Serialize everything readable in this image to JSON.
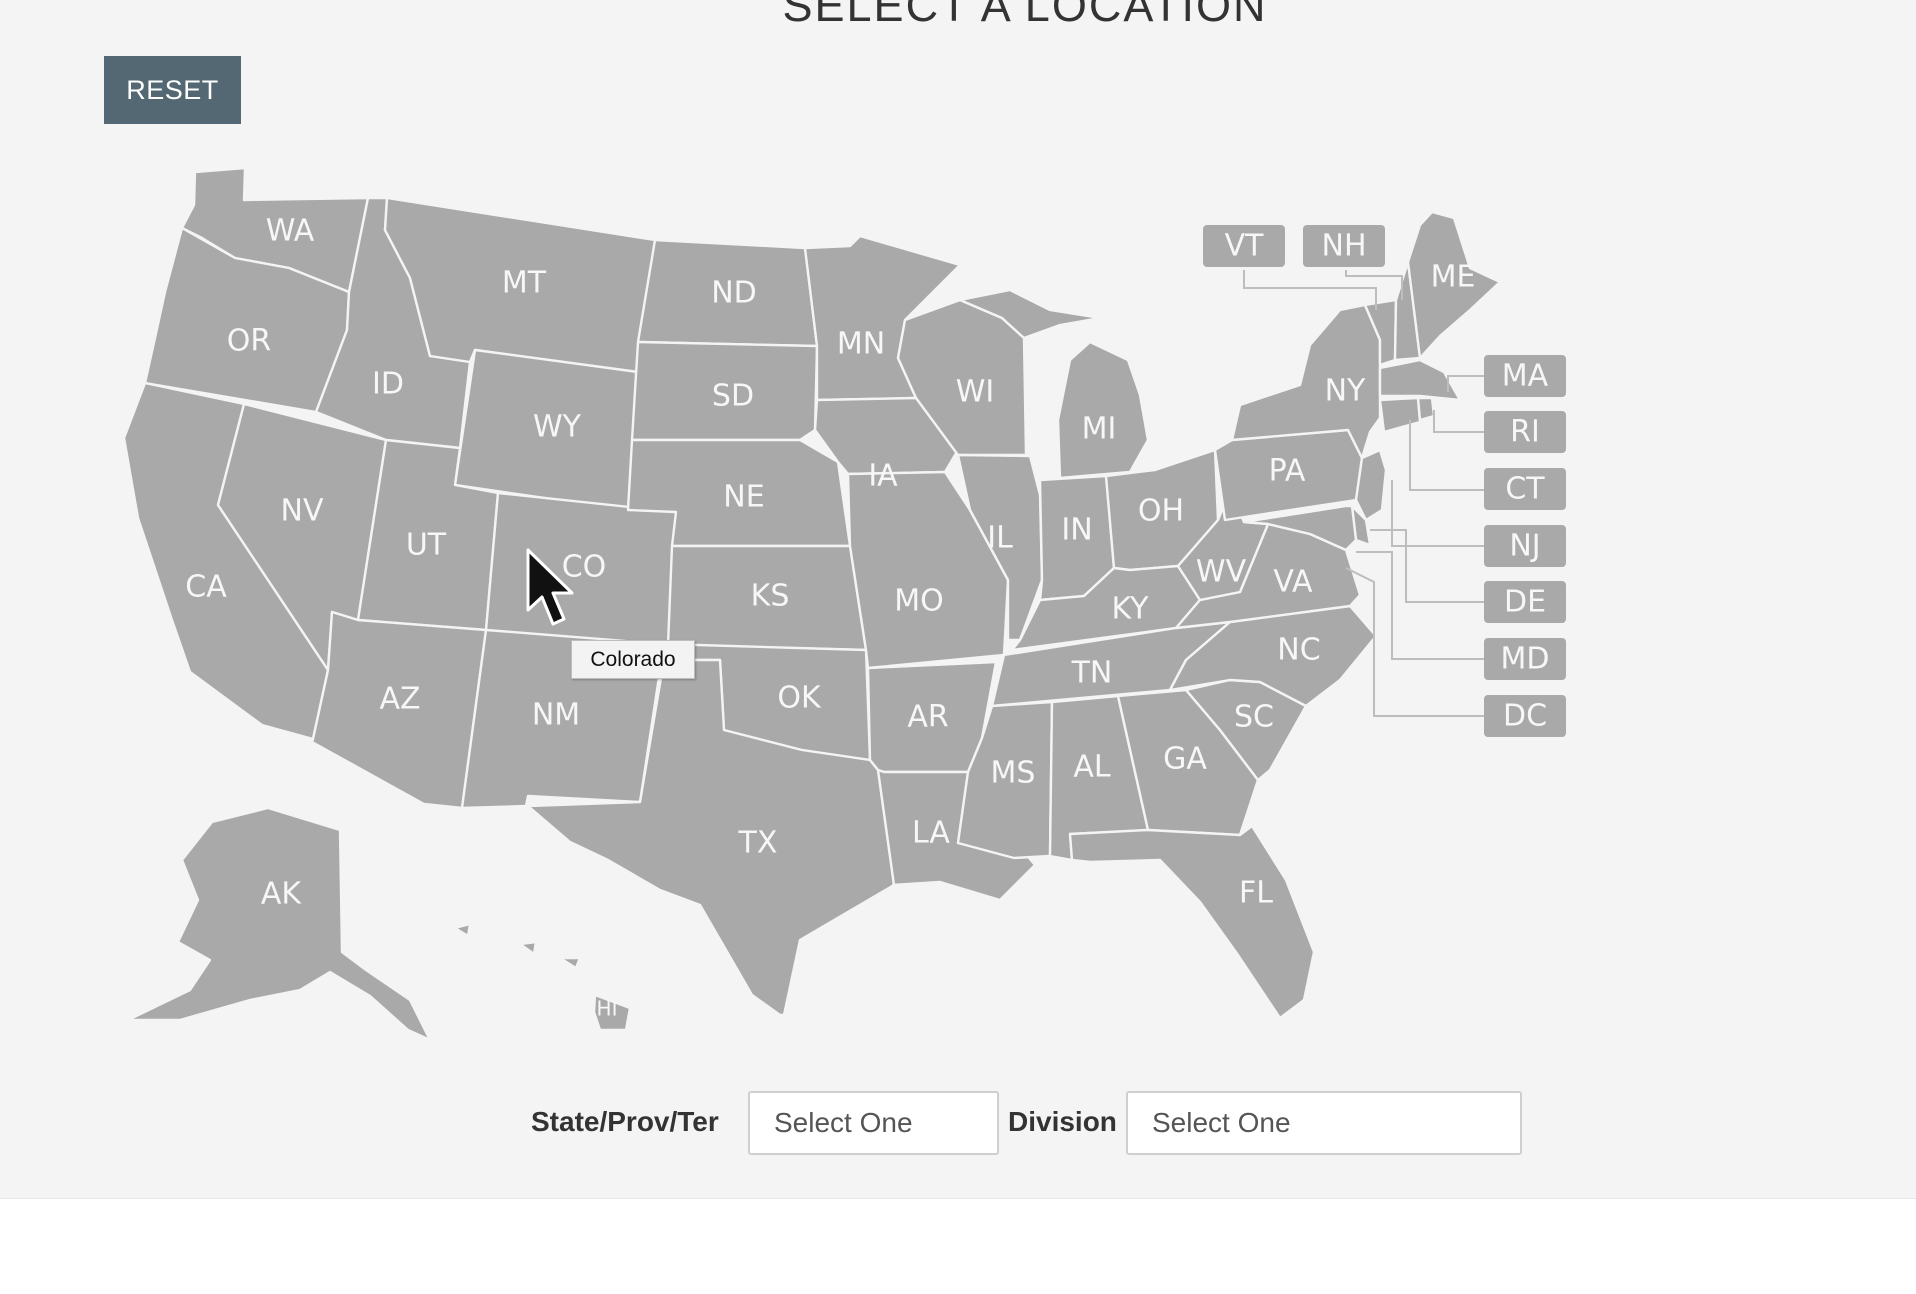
{
  "page": {
    "title": "SELECT A LOCATION"
  },
  "controls": {
    "reset_label": "RESET"
  },
  "map": {
    "states": {
      "WA": "WA",
      "OR": "OR",
      "CA": "CA",
      "ID": "ID",
      "NV": "NV",
      "MT": "MT",
      "WY": "WY",
      "UT": "UT",
      "CO": "CO",
      "AZ": "AZ",
      "NM": "NM",
      "ND": "ND",
      "SD": "SD",
      "NE": "NE",
      "KS": "KS",
      "OK": "OK",
      "TX": "TX",
      "MN": "MN",
      "IA": "IA",
      "MO": "MO",
      "AR": "AR",
      "LA": "LA",
      "WI": "WI",
      "IL": "IL",
      "MI": "MI",
      "IN": "IN",
      "OH": "OH",
      "KY": "KY",
      "TN": "TN",
      "MS": "MS",
      "AL": "AL",
      "GA": "GA",
      "FL": "FL",
      "SC": "SC",
      "NC": "NC",
      "VA": "VA",
      "WV": "WV",
      "PA": "PA",
      "NY": "NY",
      "ME": "ME",
      "AK": "AK",
      "HI": "HI"
    },
    "callouts": {
      "VT": "VT",
      "NH": "NH",
      "MA": "MA",
      "RI": "RI",
      "CT": "CT",
      "NJ": "NJ",
      "DE": "DE",
      "MD": "MD",
      "DC": "DC"
    },
    "fill_color": "#a9a9a9",
    "hovered_state": "CO",
    "tooltip": "Colorado"
  },
  "filters": {
    "state_label": "State/Prov/Ter",
    "state_value": "Select One",
    "division_label": "Division",
    "division_value": "Select One"
  }
}
